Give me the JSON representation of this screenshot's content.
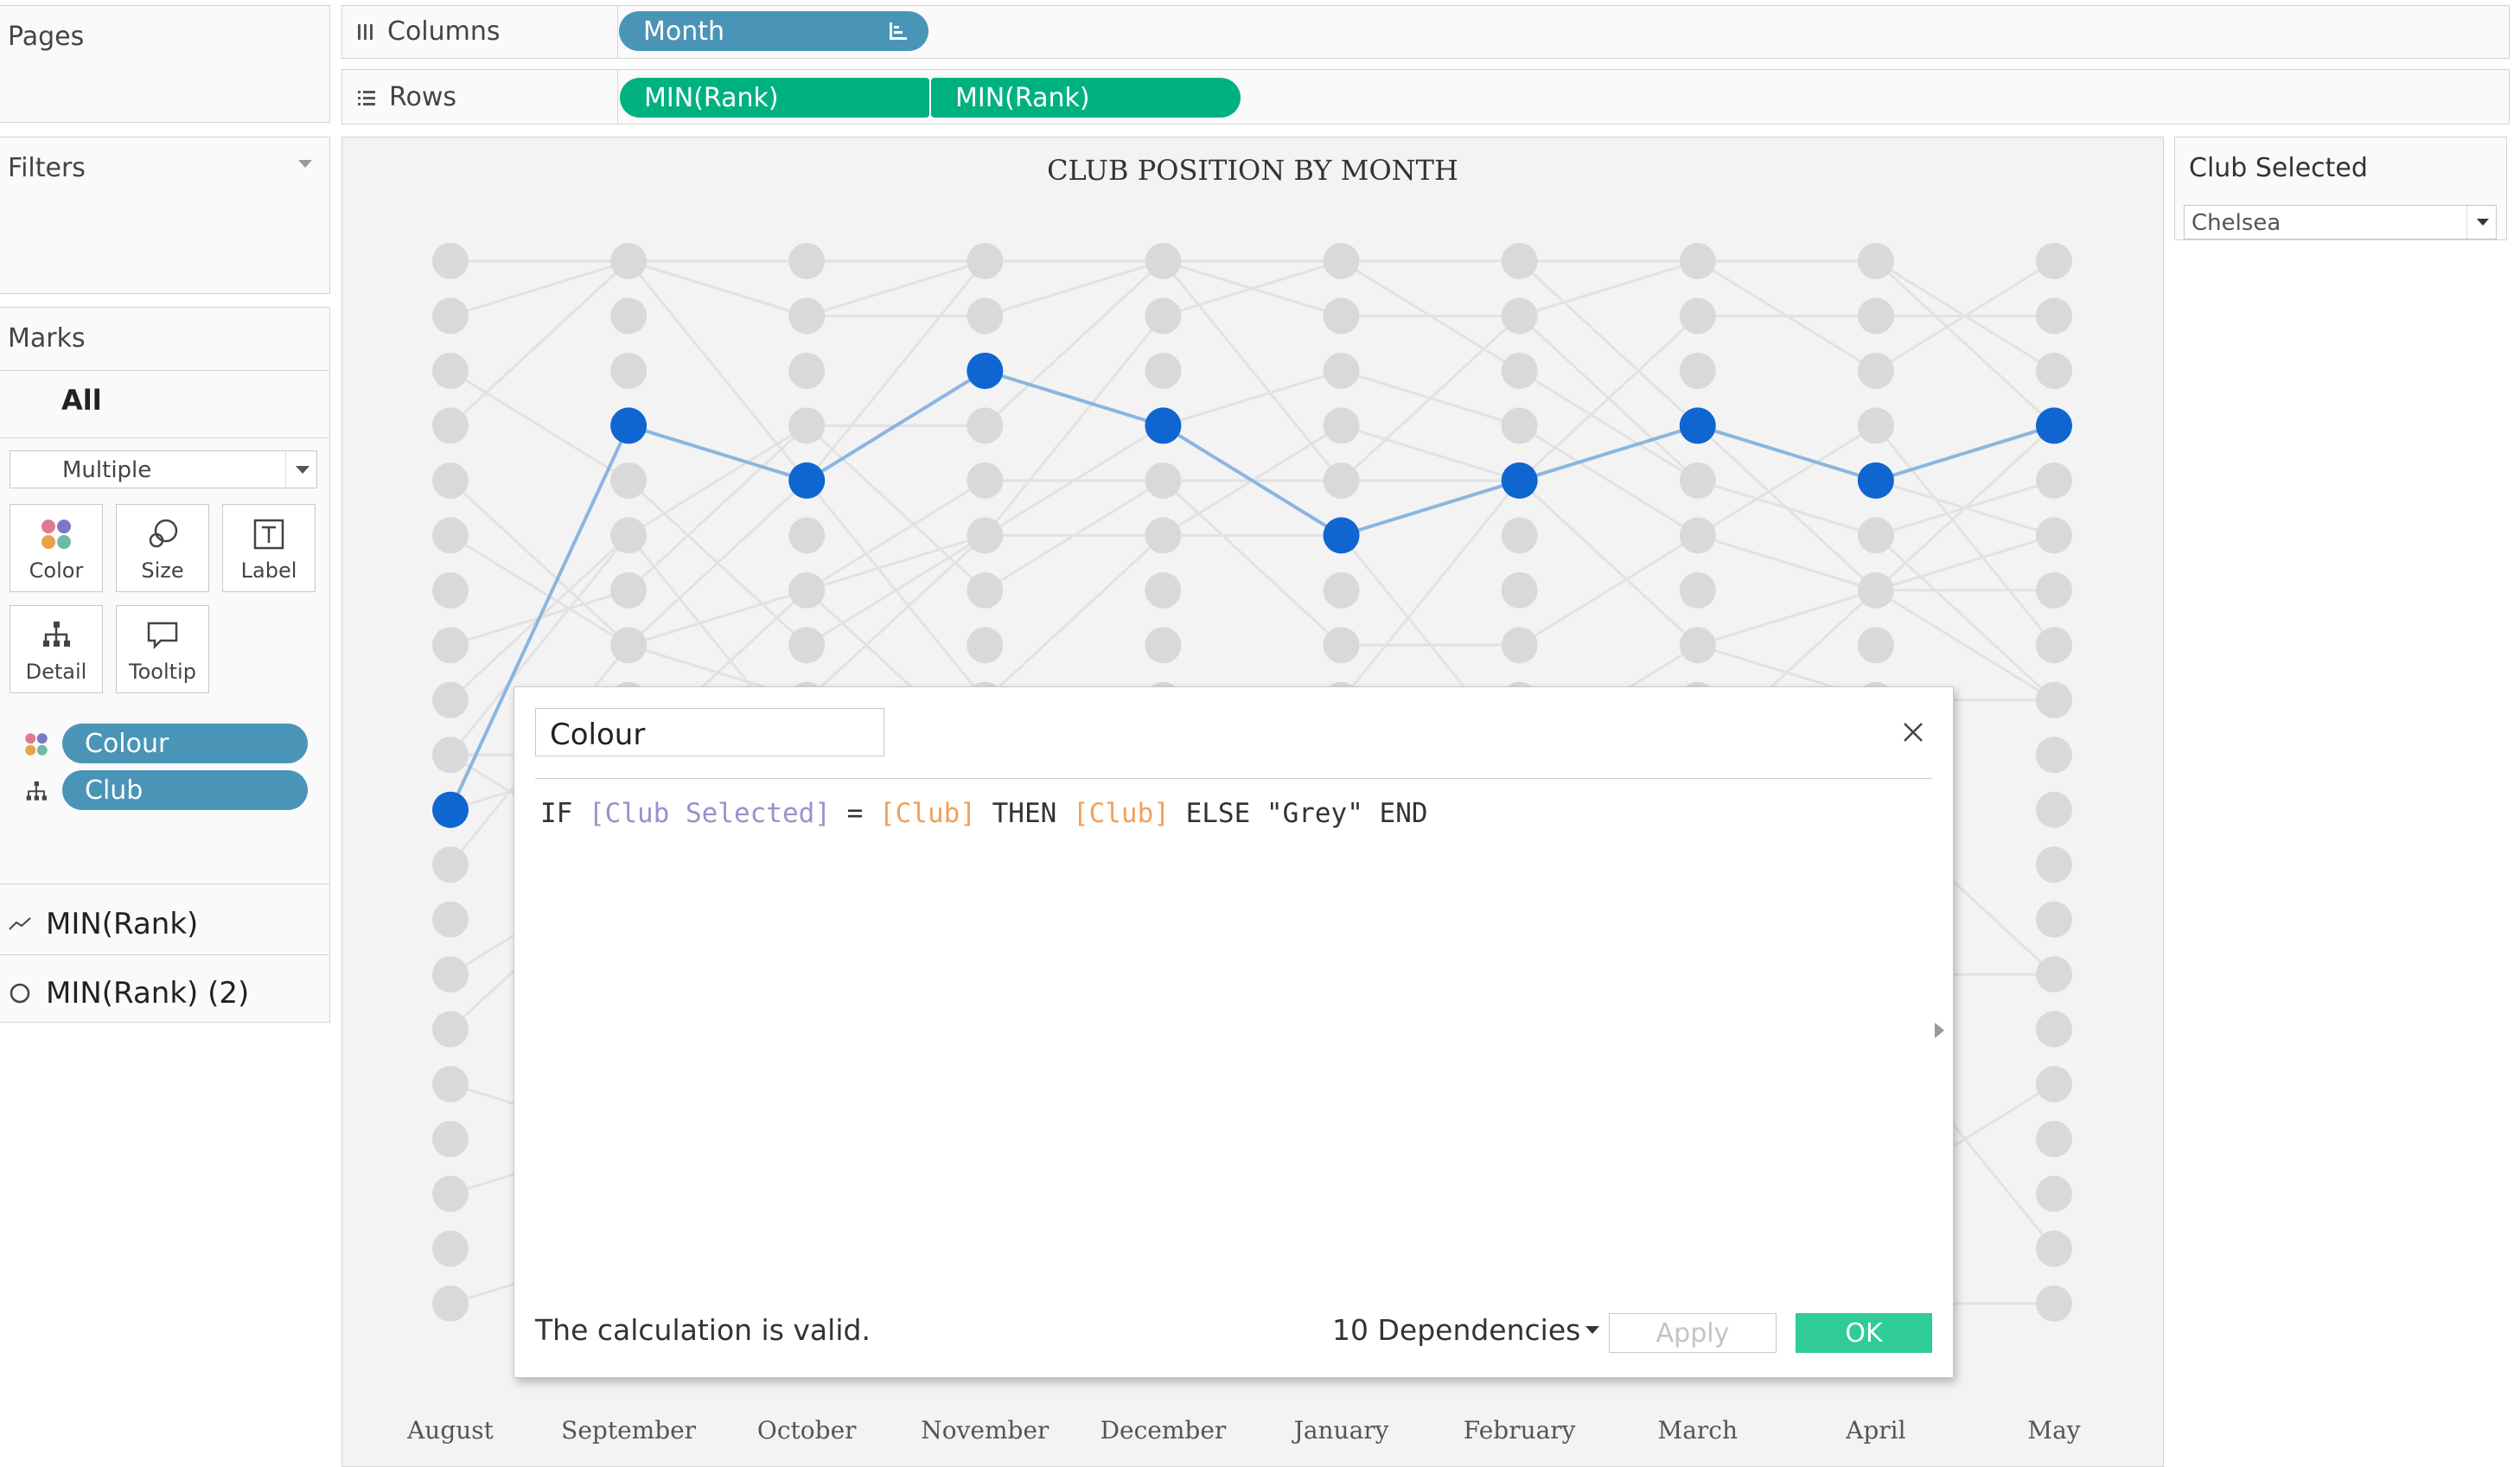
{
  "pages_panel": {
    "title": "Pages"
  },
  "columns_shelf": {
    "label": "Columns",
    "pill": "Month"
  },
  "rows_shelf": {
    "label": "Rows",
    "pills": [
      "MIN(Rank)",
      "MIN(Rank)"
    ]
  },
  "filters_panel": {
    "title": "Filters"
  },
  "marks_panel": {
    "title": "Marks",
    "all_tab": "All",
    "mark_type": "Multiple",
    "buttons": [
      "Color",
      "Size",
      "Label",
      "Detail",
      "Tooltip"
    ],
    "fields": [
      "Colour",
      "Club"
    ],
    "measures": [
      "MIN(Rank)",
      "MIN(Rank) (2)"
    ]
  },
  "parameter": {
    "title": "Club Selected",
    "value": "Chelsea"
  },
  "chart_data": {
    "type": "line",
    "title": "CLUB POSITION BY MONTH",
    "categories": [
      "August",
      "September",
      "October",
      "November",
      "December",
      "January",
      "February",
      "March",
      "April",
      "May"
    ],
    "series": [
      {
        "name": "Chelsea",
        "values": [
          11,
          4,
          5,
          3,
          4,
          6,
          5,
          4,
          5,
          4
        ]
      }
    ],
    "ranks": 20,
    "highlight_color": "#1066d1",
    "dot_color": "#d9d9d9",
    "line_color": "#8ab6e0"
  },
  "dialog": {
    "name": "Colour",
    "formula": [
      {
        "text": "IF ",
        "kind": "kw"
      },
      {
        "text": "[Club Selected]",
        "kind": "param"
      },
      {
        "text": " = ",
        "kind": "kw"
      },
      {
        "text": "[Club]",
        "kind": "field"
      },
      {
        "text": " THEN ",
        "kind": "kw"
      },
      {
        "text": "[Club]",
        "kind": "field"
      },
      {
        "text": " ELSE ",
        "kind": "kw"
      },
      {
        "text": "\"Grey\"",
        "kind": "str"
      },
      {
        "text": " END",
        "kind": "kw"
      }
    ],
    "status": "The calculation is valid.",
    "dependencies": "10 Dependencies",
    "apply_label": "Apply",
    "ok_label": "OK",
    "colors": {
      "kw": "#333333",
      "param": "#a08fc8",
      "field": "#f2a05a",
      "str": "#333333",
      "ok": "#2fcc98"
    }
  }
}
